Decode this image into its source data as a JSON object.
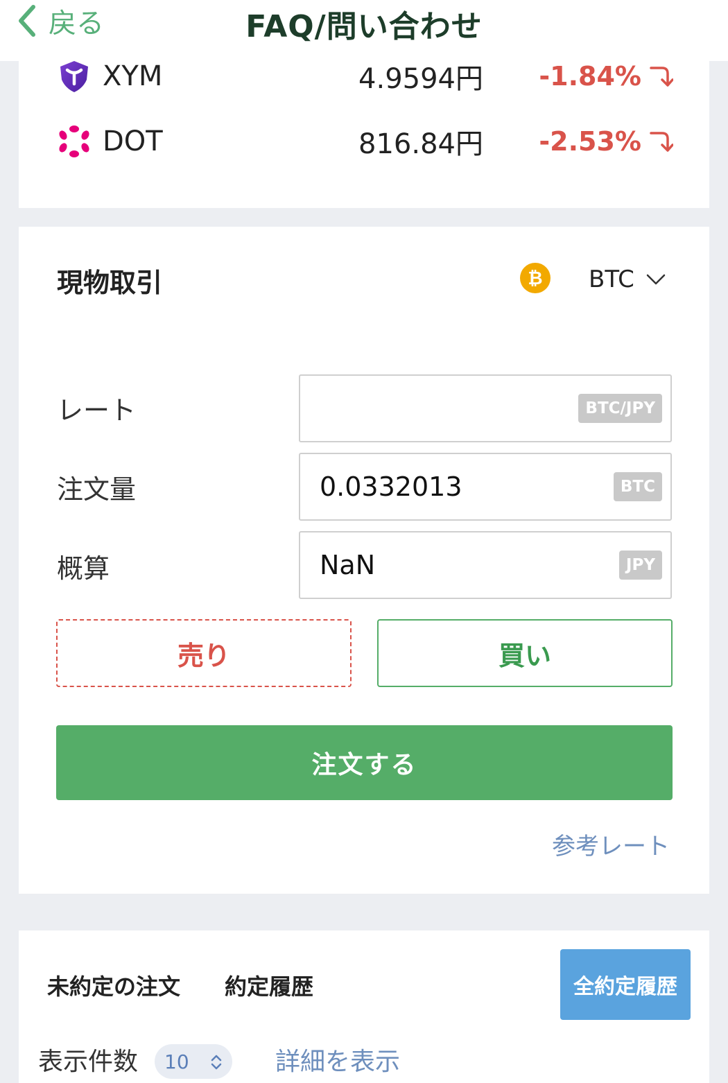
{
  "header": {
    "back_label": "戻る",
    "title": "FAQ/問い合わせ"
  },
  "ticker": [
    {
      "symbol": "XYM",
      "price": "4.9594円",
      "change": "-1.84%",
      "icon": "symbol-xym-icon"
    },
    {
      "symbol": "DOT",
      "price": "816.84円",
      "change": "-2.53%",
      "icon": "polkadot-dot-icon"
    }
  ],
  "spot": {
    "title": "現物取引",
    "selected_coin": "BTC",
    "coin_icon_glyph": "₿",
    "fields": [
      {
        "label": "レート",
        "value": "",
        "unit": "BTC/JPY"
      },
      {
        "label": "注文量",
        "value": "0.0332013",
        "unit": "BTC"
      },
      {
        "label": "概算",
        "value": "NaN",
        "unit": "JPY"
      }
    ],
    "sell_label": "売り",
    "buy_label": "買い",
    "order_label": "注文する",
    "reference_rate_label": "参考レート"
  },
  "orders": {
    "tab_open": "未約定の注文",
    "tab_history": "約定履歴",
    "all_history_label": "全約定履歴",
    "show_count_label": "表示件数",
    "show_count_value": "10",
    "details_label": "詳細を表示"
  },
  "colors": {
    "accent_green": "#55ad68",
    "sell_red": "#d9534a",
    "link_blue": "#6e8fbd",
    "btc_orange": "#f2a900",
    "history_button_blue": "#5aa3de"
  }
}
